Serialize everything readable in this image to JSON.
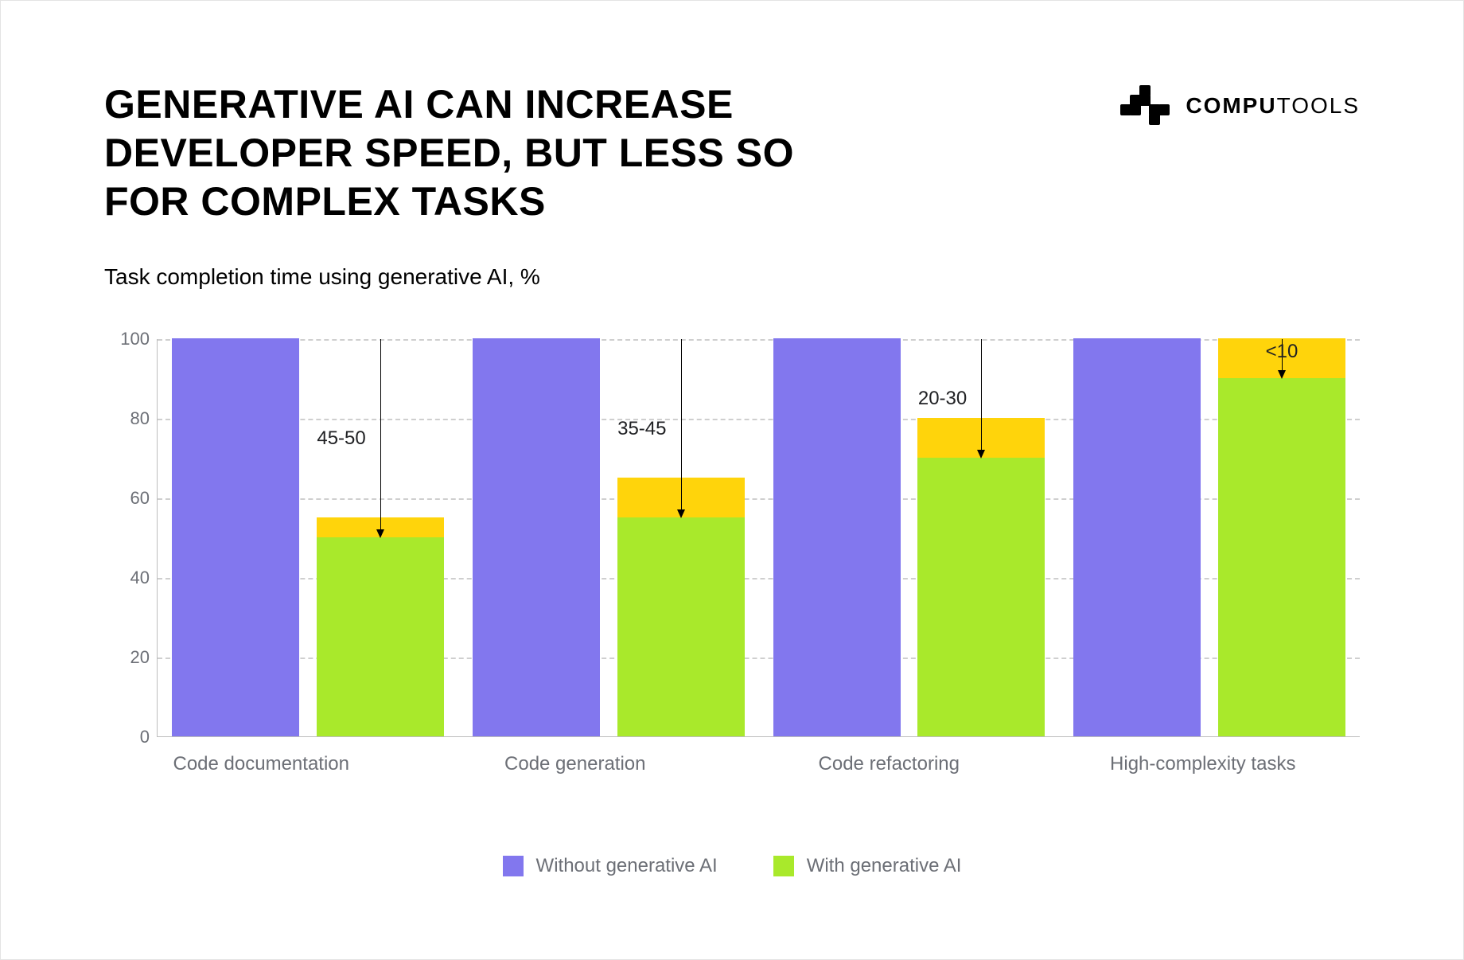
{
  "header": {
    "title": "GENERATIVE AI CAN INCREASE DEVELOPER SPEED, BUT LESS SO FOR COMPLEX TASKS",
    "brand_left": "COMPU",
    "brand_right": "TOOLS"
  },
  "subtitle": "Task completion time using generative AI, %",
  "legend": {
    "without": "Without generative AI",
    "with": "With generative AI"
  },
  "colors": {
    "without": "#8277ee",
    "with": "#a9e92b",
    "band": "#ffd40b"
  },
  "chart_data": {
    "type": "bar",
    "title": "Task completion time using generative AI, %",
    "xlabel": "",
    "ylabel": "",
    "ylim": [
      0,
      100
    ],
    "yticks": [
      0,
      20,
      40,
      60,
      80,
      100
    ],
    "categories": [
      "Code documentation",
      "Code generation",
      "Code refactoring",
      "High-complexity tasks"
    ],
    "series": [
      {
        "name": "Without generative AI",
        "values": [
          100,
          100,
          100,
          100
        ]
      },
      {
        "name": "With generative AI (lower bound)",
        "values": [
          50,
          55,
          70,
          90
        ]
      },
      {
        "name": "With generative AI (upper bound)",
        "values": [
          55,
          65,
          80,
          100
        ]
      }
    ],
    "annotations": [
      {
        "category": "Code documentation",
        "label": "45-50",
        "placement": "left"
      },
      {
        "category": "Code generation",
        "label": "35-45",
        "placement": "left"
      },
      {
        "category": "Code refactoring",
        "label": "20-30",
        "placement": "left"
      },
      {
        "category": "High-complexity tasks",
        "label": "<10",
        "placement": "above"
      }
    ]
  }
}
